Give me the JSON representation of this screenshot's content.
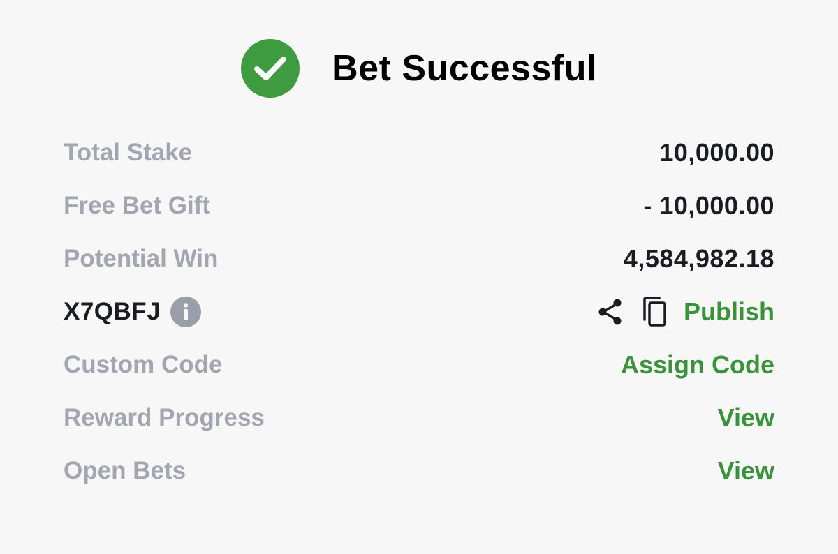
{
  "header": {
    "title": "Bet Successful"
  },
  "summary": {
    "total_stake": {
      "label": "Total Stake",
      "value": "10,000.00"
    },
    "free_bet_gift": {
      "label": "Free Bet Gift",
      "value": "- 10,000.00"
    },
    "potential_win": {
      "label": "Potential Win",
      "value": "4,584,982.18"
    }
  },
  "booking": {
    "code": "X7QBFJ",
    "publish_label": "Publish"
  },
  "custom_code": {
    "label": "Custom Code",
    "action": "Assign Code"
  },
  "reward_progress": {
    "label": "Reward Progress",
    "action": "View"
  },
  "open_bets": {
    "label": "Open Bets",
    "action": "View"
  },
  "colors": {
    "accent_green": "#3a923a",
    "label_gray": "#a2a6b0",
    "value_dark": "#1b1c22",
    "background": "#f7f7f8"
  },
  "icons": [
    "check-icon",
    "info-icon",
    "share-icon",
    "copy-icon"
  ]
}
